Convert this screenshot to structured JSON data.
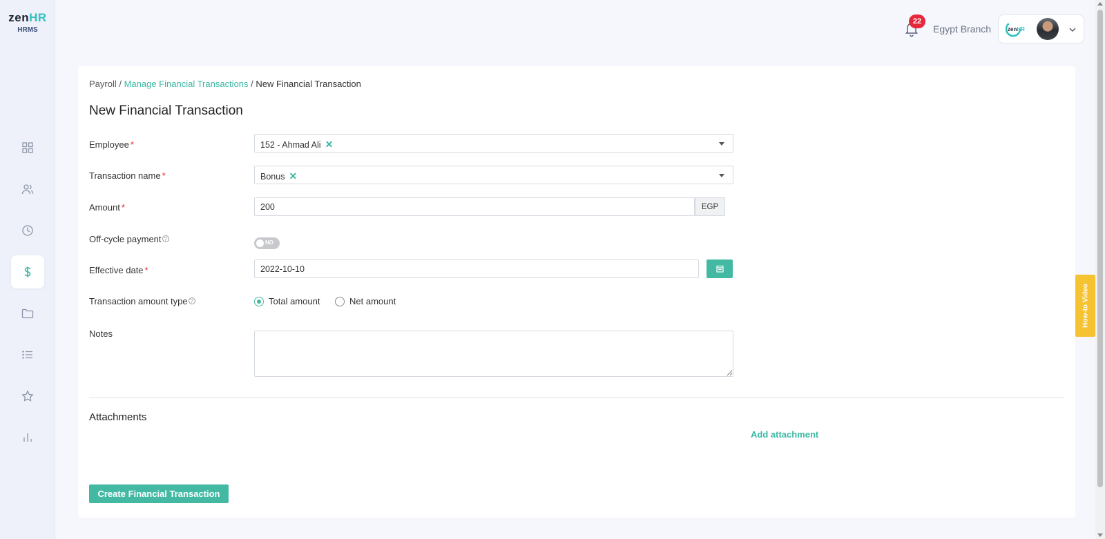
{
  "app": {
    "logo_main": "zen",
    "logo_accent": "HR",
    "logo_sub": "HRMS"
  },
  "sidebar": {
    "items": [
      {
        "icon": "dashboard-icon",
        "active": false
      },
      {
        "icon": "people-icon",
        "active": false
      },
      {
        "icon": "clock-icon",
        "active": false
      },
      {
        "icon": "dollar-icon",
        "active": true
      },
      {
        "icon": "folder-icon",
        "active": false
      },
      {
        "icon": "list-icon",
        "active": false
      },
      {
        "icon": "star-icon",
        "active": false
      },
      {
        "icon": "bar-chart-icon",
        "active": false
      }
    ]
  },
  "topbar": {
    "notification_count": "22",
    "branch": "Egypt Branch",
    "company_logo": "zenHR"
  },
  "breadcrumb": {
    "root": "Payroll",
    "separator": " / ",
    "parent": "Manage Financial Transactions",
    "current": "New Financial Transaction"
  },
  "page": {
    "title": "New Financial Transaction"
  },
  "form": {
    "employee": {
      "label": "Employee",
      "required_mark": "*",
      "value": "152 - Ahmad Ali",
      "clear": "✕"
    },
    "transaction_name": {
      "label": "Transaction name",
      "required_mark": "*",
      "value": "Bonus",
      "clear": "✕"
    },
    "amount": {
      "label": "Amount",
      "required_mark": "*",
      "value": "200",
      "currency": "EGP"
    },
    "off_cycle": {
      "label": "Off-cycle payment",
      "help": "?",
      "toggle_text": "NO"
    },
    "effective_date": {
      "label": "Effective date",
      "required_mark": "*",
      "value": "2022-10-10"
    },
    "amount_type": {
      "label": "Transaction amount type",
      "help": "?",
      "options": [
        "Total amount",
        "Net amount"
      ],
      "selected": "Total amount"
    },
    "notes": {
      "label": "Notes",
      "value": ""
    }
  },
  "attachments": {
    "title": "Attachments",
    "add_label": "Add attachment"
  },
  "actions": {
    "submit_label": "Create Financial Transaction"
  },
  "how_to": {
    "label": "How-to Video"
  },
  "colors": {
    "accent": "#43b9a4",
    "link": "#3bb7a3",
    "required": "#e6283d",
    "badge": "#e6283d",
    "how_to_bg": "#f5c232"
  }
}
